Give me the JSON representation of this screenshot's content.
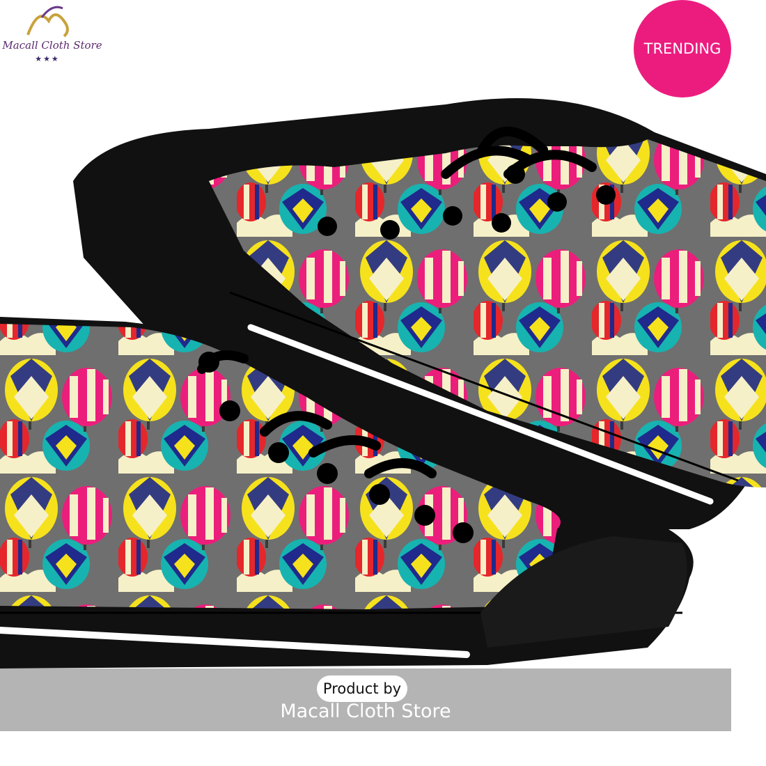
{
  "logo": {
    "name": "Macall Cloth Store",
    "stars": "★★★",
    "mark": "monogram-logo-icon"
  },
  "badge": {
    "label": "TRENDING",
    "color": "#ec1c7f"
  },
  "image": {
    "subject": "sneaker-pair-illustration",
    "colors": {
      "sole": "#111111",
      "canvas_bg": "#6f6f6f",
      "pink": "#ec1e7c",
      "navy": "#1f2a8c",
      "teal": "#17b3b0",
      "yellow": "#f6e21c",
      "red": "#e5262b",
      "cream": "#f6f0c8"
    }
  },
  "caption": {
    "label": "Product by",
    "store": "Macall Cloth Store"
  }
}
